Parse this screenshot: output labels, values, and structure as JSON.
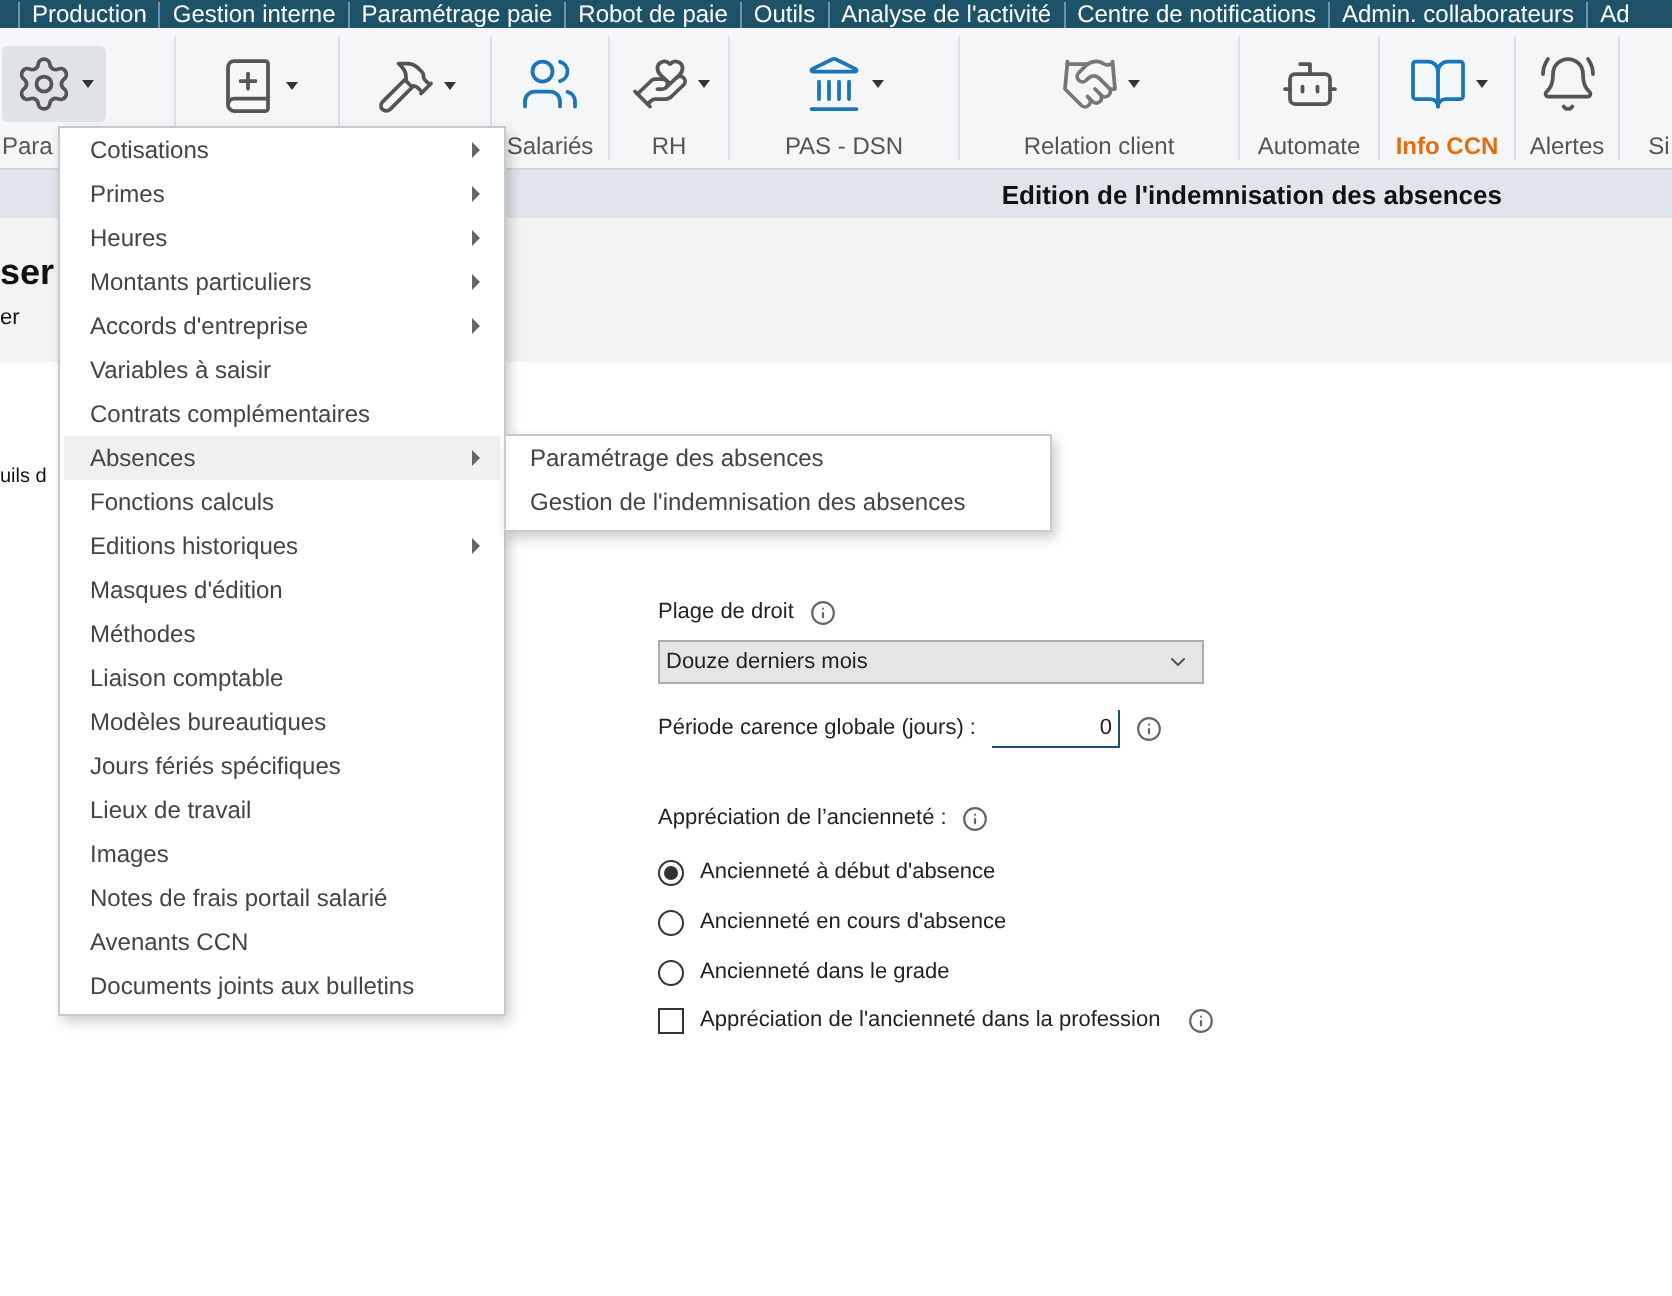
{
  "menu_bar": [
    "Production",
    "Gestion interne",
    "Paramétrage paie",
    "Robot de paie",
    "Outils",
    "Analyse de l'activité",
    "Centre de notifications",
    "Admin. collaborateurs",
    "Ad"
  ],
  "ribbon": [
    {
      "label": "Para",
      "kind": "settings",
      "active": true
    },
    {
      "kind": "book"
    },
    {
      "kind": "tools"
    },
    {
      "label": "Salariés",
      "kind": "users"
    },
    {
      "label": "RH",
      "kind": "hand"
    },
    {
      "label": "PAS - DSN",
      "kind": "bank"
    },
    {
      "label": "Relation client",
      "kind": "client"
    },
    {
      "label": "Automate",
      "kind": "bot"
    },
    {
      "label": "Info CCN",
      "kind": "info",
      "highlight": true
    },
    {
      "label": "Alertes",
      "kind": "bell"
    },
    {
      "label": "Si",
      "kind": "none"
    }
  ],
  "page_title": "Edition de l'indemnisation des absences",
  "left_fragments": {
    "heading": "ser",
    "subheading": "er",
    "text": "uils d"
  },
  "form": {
    "plage_label": "Plage de droit",
    "plage_value": "Douze derniers mois",
    "carence_label": "Période carence globale (jours) :",
    "carence_value": "0",
    "anciennete_label": "Appréciation de l’ancienneté :",
    "radios": [
      {
        "label": "Ancienneté à début d'absence",
        "selected": true
      },
      {
        "label": "Ancienneté en cours d'absence",
        "selected": false
      },
      {
        "label": "Ancienneté dans le grade",
        "selected": false
      }
    ],
    "checkbox": {
      "label": "Appréciation de l'ancienneté dans la profession",
      "checked": false
    }
  },
  "dropdown_menu": [
    {
      "label": "Cotisations",
      "submenu": true,
      "selected": false
    },
    {
      "label": "Primes",
      "submenu": true,
      "selected": false
    },
    {
      "label": "Heures",
      "submenu": true,
      "selected": false
    },
    {
      "label": "Montants particuliers",
      "submenu": true,
      "selected": false
    },
    {
      "label": "Accords d'entreprise",
      "submenu": true,
      "selected": false
    },
    {
      "label": "Variables à saisir",
      "submenu": false,
      "selected": false
    },
    {
      "label": "Contrats complémentaires",
      "submenu": false,
      "selected": false
    },
    {
      "label": "Absences",
      "submenu": true,
      "selected": true
    },
    {
      "label": "Fonctions calculs",
      "submenu": false,
      "selected": false
    },
    {
      "label": "Editions historiques",
      "submenu": true,
      "selected": false
    },
    {
      "label": "Masques d'édition",
      "submenu": false,
      "selected": false
    },
    {
      "label": "Méthodes",
      "submenu": false,
      "selected": false
    },
    {
      "label": "Liaison comptable",
      "submenu": false,
      "selected": false
    },
    {
      "label": "Modèles bureautiques",
      "submenu": false,
      "selected": false
    },
    {
      "label": "Jours fériés spécifiques",
      "submenu": false,
      "selected": false
    },
    {
      "label": "Lieux de travail",
      "submenu": false,
      "selected": false
    },
    {
      "label": "Images",
      "submenu": false,
      "selected": false
    },
    {
      "label": "Notes de frais portail salarié",
      "submenu": false,
      "selected": false
    },
    {
      "label": "Avenants CCN",
      "submenu": false,
      "selected": false
    },
    {
      "label": "Documents joints aux bulletins",
      "submenu": false,
      "selected": false
    }
  ],
  "submenu": [
    "Paramétrage des absences",
    "Gestion de l'indemnisation des absences"
  ]
}
